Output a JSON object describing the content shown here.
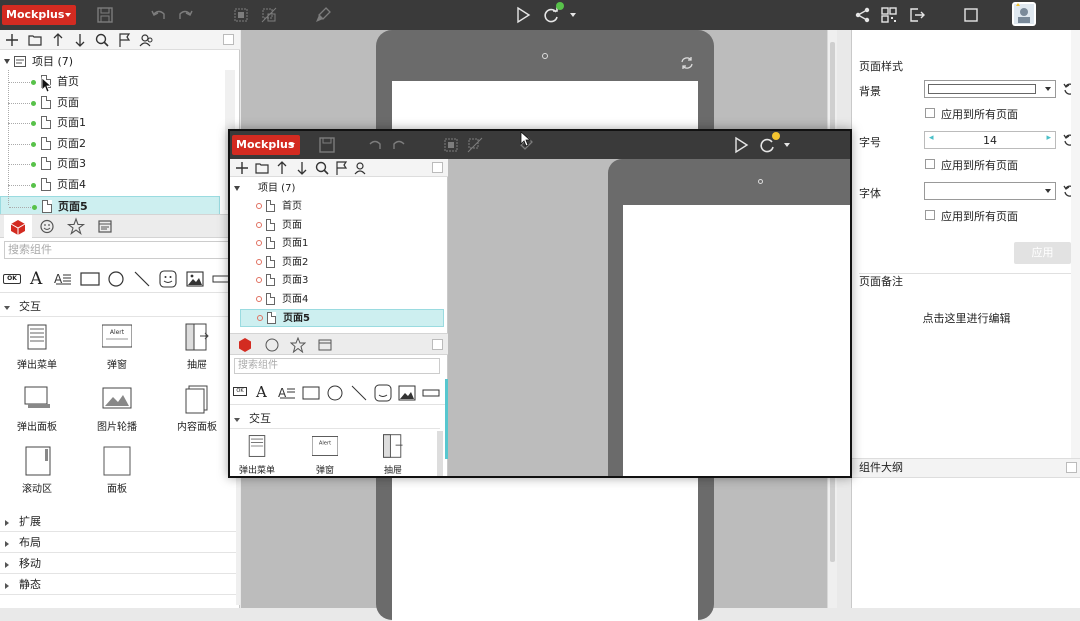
{
  "app": {
    "brand": "Mockplus"
  },
  "pages_panel": {
    "root_label": "项目 (7)",
    "pages": [
      "首页",
      "页面",
      "页面1",
      "页面2",
      "页面3",
      "页面4",
      "页面5"
    ],
    "selected": "页面5"
  },
  "library": {
    "search_placeholder": "搜索组件",
    "shape_ok_label": "OK",
    "sections": [
      {
        "label": "交互",
        "expanded": true,
        "items": [
          "弹出菜单",
          "弹窗",
          "抽屉",
          "弹出面板",
          "图片轮播",
          "内容面板",
          "滚动区",
          "面板"
        ]
      },
      {
        "label": "扩展",
        "expanded": false
      },
      {
        "label": "布局",
        "expanded": false
      },
      {
        "label": "移动",
        "expanded": false
      },
      {
        "label": "静态",
        "expanded": false
      }
    ],
    "alert_glyph_text": "Alert"
  },
  "properties": {
    "page_style_title": "页面样式",
    "background_label": "背景",
    "apply_all_label": "应用到所有页面",
    "font_size_label": "字号",
    "font_size_value": "14",
    "font_label": "字体",
    "apply_button": "应用",
    "notes_title": "页面备注",
    "notes_placeholder": "点击这里进行编辑",
    "outline_title": "组件大纲"
  },
  "overlay": {
    "brand": "Mockplus",
    "root_label": "项目 (7)",
    "pages": [
      "首页",
      "页面",
      "页面1",
      "页面2",
      "页面3",
      "页面4",
      "页面5"
    ],
    "search_placeholder": "搜索组件",
    "section_label": "交互",
    "items": [
      "弹出菜单",
      "弹窗",
      "抽屉"
    ],
    "alert_glyph_text": "Alert",
    "shape_ok_label": "OK"
  },
  "colors": {
    "brand_red": "#d32b21",
    "selection": "#cdeff0",
    "dark_toolbar": "#3a3a3a",
    "accent_teal": "#57c7cf"
  }
}
